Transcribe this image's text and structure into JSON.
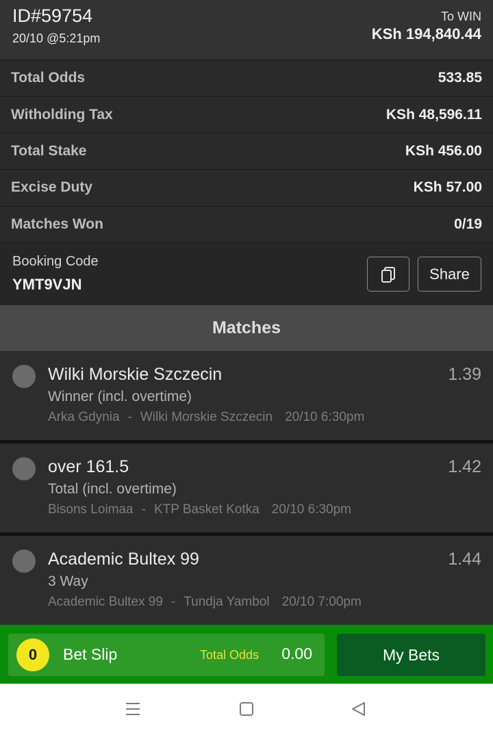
{
  "header": {
    "bet_id": "ID#59754",
    "date": "20/10 @5:21pm",
    "to_win_label": "To WIN",
    "to_win_value": "KSh 194,840.44"
  },
  "summary": [
    {
      "label": "Total Odds",
      "value": "533.85"
    },
    {
      "label": "Witholding Tax",
      "value": "KSh 48,596.11"
    },
    {
      "label": "Total Stake",
      "value": "KSh 456.00"
    },
    {
      "label": "Excise Duty",
      "value": "KSh 57.00"
    },
    {
      "label": "Matches Won",
      "value": "0/19"
    }
  ],
  "booking": {
    "label": "Booking Code",
    "code": "YMT9VJN",
    "copy_icon": "copy-icon",
    "share_label": "Share"
  },
  "matches_title": "Matches",
  "matches": [
    {
      "selection": "Wilki Morskie Szczecin",
      "odds": "1.39",
      "market": "Winner (incl. overtime)",
      "home": "Arka Gdynia",
      "separator": "-",
      "away": "Wilki Morskie Szczecin",
      "time": "20/10 6:30pm"
    },
    {
      "selection": "over 161.5",
      "odds": "1.42",
      "market": "Total (incl. overtime)",
      "home": "Bisons Loimaa",
      "separator": "-",
      "away": "KTP Basket Kotka",
      "time": "20/10 6:30pm"
    },
    {
      "selection": "Academic Bultex 99",
      "odds": "1.44",
      "market": "3 Way",
      "home": "Academic Bultex 99",
      "separator": "-",
      "away": "Tundja Yambol",
      "time": "20/10 7:00pm"
    }
  ],
  "betslip": {
    "count": "0",
    "label": "Bet Slip",
    "total_odds_label": "Total Odds",
    "total_odds_value": "0.00",
    "my_bets_label": "My Bets"
  },
  "navbar": {
    "icons": [
      "menu-icon",
      "home-square-icon",
      "back-triangle-icon"
    ]
  },
  "colors": {
    "brand_green": "#0a8c0a",
    "betslip_green": "#2e9a28",
    "mybets_green": "#0a5c22",
    "badge_yellow": "#f2e61f"
  }
}
